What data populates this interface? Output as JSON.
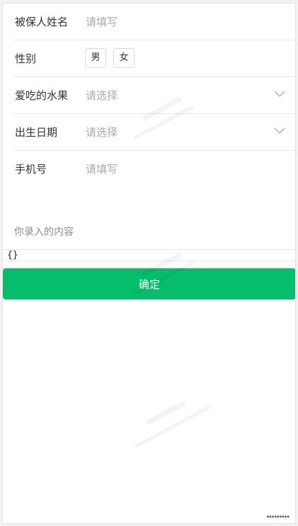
{
  "form": {
    "name": {
      "label": "被保人姓名",
      "placeholder": "请填写"
    },
    "gender": {
      "label": "性别",
      "options": [
        "男",
        "女"
      ]
    },
    "fruit": {
      "label": "爱吃的水果",
      "placeholder": "请选择"
    },
    "birthday": {
      "label": "出生日期",
      "placeholder": "请选择"
    },
    "phone": {
      "label": "手机号",
      "placeholder": "请填写"
    }
  },
  "entered": {
    "label": "你录入的内容",
    "value": "{}"
  },
  "submit_label": "确定",
  "colors": {
    "primary": "#06bd6b",
    "placeholder": "#a8a8a8",
    "label": "#333333"
  },
  "icons": [
    "chevron-down-icon"
  ]
}
